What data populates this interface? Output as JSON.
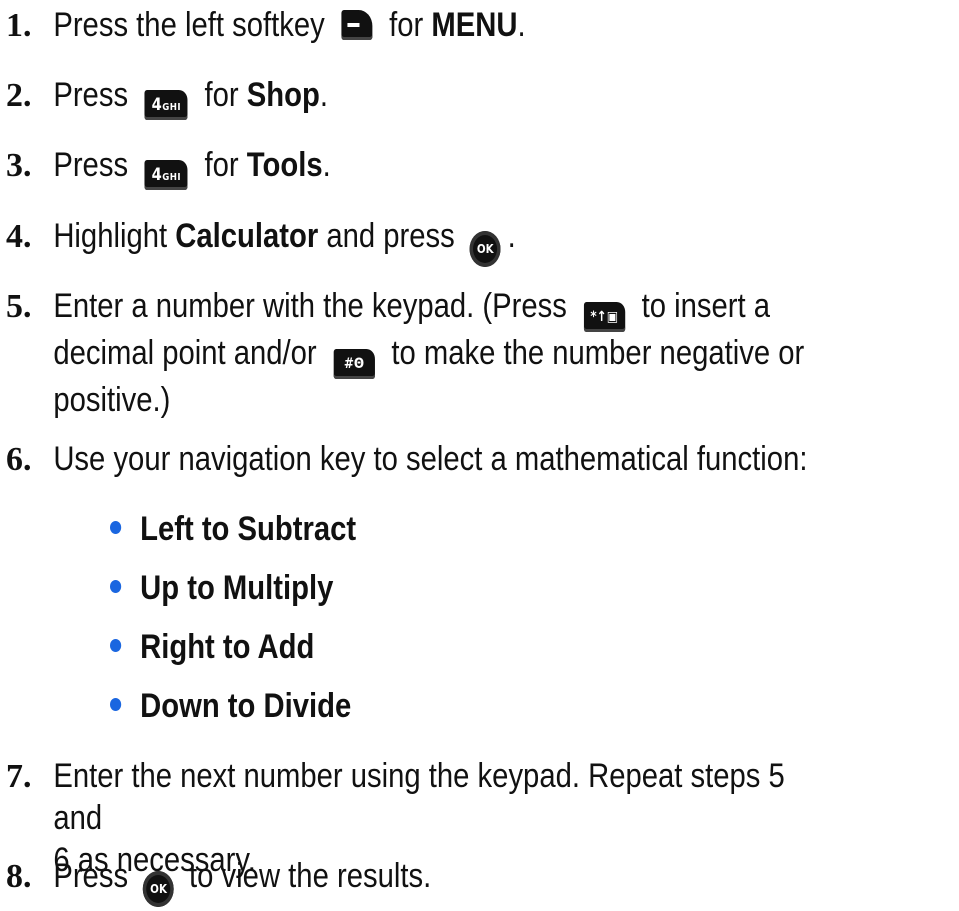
{
  "steps": [
    {
      "num": "1.",
      "pre": "Press the left softkey",
      "post": "for",
      "bold": "MENU",
      "end": "."
    },
    {
      "num": "2.",
      "pre": "Press",
      "key": "4GHI",
      "post": "for",
      "bold": "Shop",
      "end": "."
    },
    {
      "num": "3.",
      "pre": "Press",
      "key": "4GHI",
      "post": "for",
      "bold": "Tools",
      "end": "."
    },
    {
      "num": "4.",
      "pre": "Highlight",
      "bold": "Calculator",
      "post": "and press",
      "end": "."
    },
    {
      "num": "5.",
      "line1_pre": "Enter a number with the keypad. (Press",
      "line1_post": "to insert a",
      "line2_pre": "decimal point and/or",
      "line2_post": "to make the number negative or",
      "line3": "positive.)"
    },
    {
      "num": "6.",
      "text": "Use your navigation key to select a mathematical function:"
    },
    {
      "num": "7.",
      "line1": "Enter the next number using the keypad. Repeat steps 5 and",
      "line2": "6 as necessary."
    },
    {
      "num": "8.",
      "pre": "Press",
      "post": "to view the results."
    }
  ],
  "functions": [
    "Left to Subtract",
    "Up to Multiply",
    "Right to Add",
    "Down to Divide"
  ],
  "keys": {
    "num4_digit": "4",
    "num4_letters": "GHI",
    "ok": "OK",
    "star": "*↑▣",
    "pound": "#Θ"
  },
  "colors": {
    "bullet": "#1a66e0",
    "text": "#111111"
  }
}
